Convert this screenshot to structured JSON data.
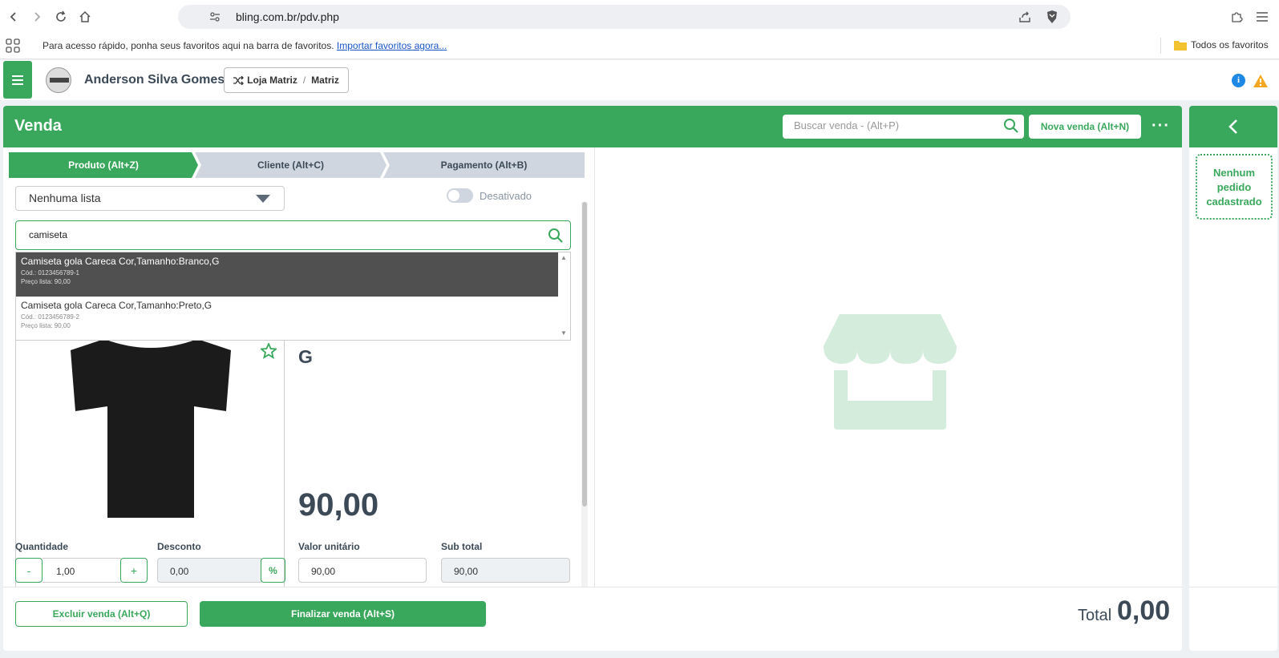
{
  "browser": {
    "url": "bling.com.br/pdv.php",
    "bookmarks_hint": "Para acesso rápido, ponha seus favoritos aqui na barra de favoritos.",
    "bookmarks_import_link": "Importar favoritos agora...",
    "all_bookmarks": "Todos os favoritos"
  },
  "header": {
    "user_name": "Anderson Silva Gomes",
    "store_label": "Loja Matriz",
    "store_sep": "/",
    "store_sub": "Matriz"
  },
  "main": {
    "title": "Venda",
    "search_placeholder": "Buscar venda - (Alt+P)",
    "new_sale_label": "Nova venda  (Alt+N)",
    "more_label": "···"
  },
  "steps": [
    {
      "label": "Produto (Alt+Z)",
      "active": true
    },
    {
      "label": "Cliente (Alt+C)",
      "active": false
    },
    {
      "label": "Pagamento (Alt+B)",
      "active": false
    }
  ],
  "product_panel": {
    "price_list_value": "Nenhuma lista",
    "toggle_label": "Desativado",
    "search_value": "camiseta",
    "results": [
      {
        "title": "Camiseta gola Careca Cor,Tamanho:Branco,G",
        "code": "Cód.: 0123456789-1",
        "price": "Preço lista: 90,00",
        "selected": true
      },
      {
        "title": "Camiseta gola Careca Cor,Tamanho:Preto,G",
        "code": "Cód.: 0123456789-2",
        "price": "Preço lista: 90,00",
        "selected": false
      }
    ],
    "product_title": "a Careca Cor,Tamanho:Preto, G",
    "product_price": "90,00"
  },
  "fields": {
    "quantity_label": "Quantidade",
    "quantity_value": "1,00",
    "minus": "-",
    "plus": "+",
    "discount_label": "Desconto",
    "discount_value": "0,00",
    "discount_unit": "%",
    "unit_value_label": "Valor unitário",
    "unit_value": "90,00",
    "subtotal_label": "Sub total",
    "subtotal_value": "90,00"
  },
  "footer": {
    "delete_label": "Excluir venda (Alt+Q)",
    "finish_label": "Finalizar venda (Alt+S)",
    "total_label": "Total",
    "total_value": "0,00"
  },
  "orders_panel": {
    "empty_text": "Nenhum pedido cadastrado"
  },
  "colors": {
    "brand_green": "#3aa85c",
    "text_dark": "#3c4a58",
    "info_blue": "#1e88e5",
    "warning_orange": "#f5a623"
  },
  "icons": [
    "back-icon",
    "forward-icon",
    "reload-icon",
    "home-icon",
    "bookmark-icon",
    "site-info-icon",
    "share-icon",
    "brave-shield-icon",
    "extensions-icon",
    "browser-menu-icon",
    "apps-icon",
    "folder-icon",
    "hamburger-icon",
    "shuffle-icon",
    "info-icon",
    "warning-icon",
    "search-icon",
    "star-icon",
    "zoom-icon",
    "chevron-left-icon",
    "store-icon"
  ]
}
